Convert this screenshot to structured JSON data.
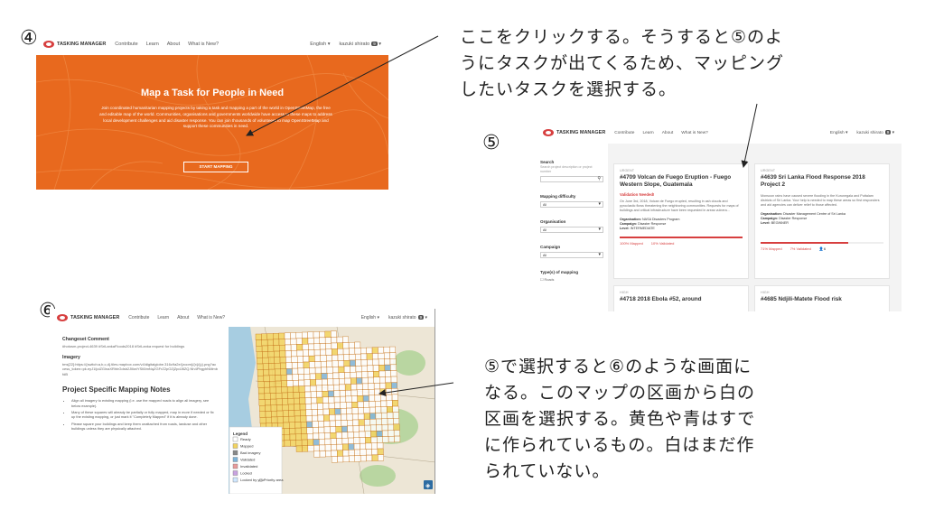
{
  "steps": {
    "four": "④",
    "five": "⑤",
    "six": "⑥"
  },
  "note_top": {
    "lines": [
      "ここをクリックする。そうすると⑤のよ",
      "うにタスクが出てくるため、マッピング",
      "したいタスクを選択する。"
    ]
  },
  "note_bottom": {
    "lines": [
      "⑤で選択すると⑥のような画面に",
      "なる。このマップの区画から白の",
      "区画を選択する。黄色や青はすで",
      "に作られているもの。白はまだ作",
      "られていない。"
    ]
  },
  "nav": {
    "logo_text": "TASKING MANAGER",
    "links": [
      "Contribute",
      "Learn",
      "About",
      "What is New?"
    ],
    "language": "English",
    "user": "kazuki shirato",
    "user_badge": "9"
  },
  "hero": {
    "title": "Map a Task for People in Need",
    "body": "Join coordinated humanitarian mapping projects by taking a task and mapping a part of the world in OpenStreetMap, the free and editable map of the world. Communities, organisations and governments worldwide have access to these maps to address local development challenges and aid disaster response. You can join thousands of volunteers to map OpenStreetMap and support these communities in need.",
    "button": "START MAPPING"
  },
  "filters": {
    "search_label": "Search",
    "search_hint": "Search project description or project number",
    "mapping_difficulty": "Mapping difficulty",
    "organisation": "Organisation",
    "campaign": "Campaign",
    "select_value": "All",
    "types_label": "Type(s) of mapping",
    "types_first": "Roads"
  },
  "cards": [
    {
      "priority": "URGENT",
      "title": "#4709 Volcan de Fuego Eruption - Fuego Western Slope, Guatemala",
      "validation": "Validation Needed!",
      "description": "On June 3rd, 2018, Volcan de Fuego erupted, resulting in ash clouds and pyroclastic flows threatening the neighboring communities. Requests for maps of buildings and critical infrastructure have been requested in areas vulnera...",
      "org_label": "Organisation:",
      "org": "NASA Disasters Program",
      "campaign_label": "Campaign:",
      "campaign": "Disaster Response",
      "level_label": "Level:",
      "level": "INTERMEDIATE",
      "mapped": "100% Mapped",
      "validated": "10% Validated",
      "mapped_fraction": 1.0
    },
    {
      "priority": "URGENT",
      "title": "#4639 Sri Lanka Flood Response 2018 Project 2",
      "validation": "",
      "description": "Monsoon rains have caused severe flooding in the Kurunegala and Puttalam districts of Sri Lanka. Your help is needed to map these areas so first responders and aid agencies can deliver relief to those affected.",
      "org_label": "Organisation:",
      "org": "Disaster Management Centre of Sri Lanka",
      "campaign_label": "Campaign:",
      "campaign": "Disaster Response",
      "level_label": "Level:",
      "level": "BEGINNER",
      "mapped": "71% Mapped",
      "validated": "7% Validated",
      "extra": "6",
      "mapped_fraction": 0.71
    },
    {
      "priority": "HIGH",
      "title": "#4718 2018 Ebola #52, around",
      "validation": "",
      "description": "",
      "mapped_fraction": 0
    },
    {
      "priority": "HIGH",
      "title": "#4685 Ndjili-Matete Flood risk",
      "validation": "",
      "description": "",
      "mapped_fraction": 0
    }
  ],
  "detail": {
    "changeset_label": "Changeset Comment",
    "changeset": "#hotosm-project-4639 #SriLankaFloods2018 #SriLanka request for buildings",
    "imagery_label": "Imagery",
    "imagery": "tms[22]:https://{switch:a,b,c,d}.tiles.mapbox.com/v4/digitalglobe.316c9a2e/{zoom}/{x}/{y}.png?access_token=pk.eyJ1IjoiZGlnaXRhbGdsb2JlIiwiYSI6ImNqZGFrZ2pOZjZpdJ8ZQ.Nh4PbgyhNMmbfdB",
    "notes_title": "Project Specific Mapping Notes",
    "notes": [
      "Align all imagery to existing mapping (i.e. use the mapped roads to align all imagery, see below example).",
      "Many of these squares will already be partially or fully mapped, map in more if needed or fix up the existing mapping, or just mark it \"Completely Mapped\" if it is already done.",
      "Please square your buildings and keep them unattached from roads, landuse and other buildings unless they are physically attached."
    ]
  },
  "legend": {
    "title": "Legend",
    "items": [
      "Ready",
      "Mapped",
      "Bad imagery",
      "Validated",
      "Invalidated",
      "Locked",
      "Locked by you"
    ],
    "colors": [
      "#ffffff",
      "#f2d35f",
      "#888888",
      "#7fb4d9",
      "#e89a9a",
      "#c8a2e0",
      "#d0e8ff"
    ],
    "priority": "Priority area"
  },
  "colors": {
    "hero_orange": "#e8691e",
    "brand_red": "#d73f3f",
    "grid_yellow": "#f2d35f",
    "grid_white": "#ffffff",
    "grid_blue": "#7fb4d9",
    "land": "#ede6d6",
    "sea": "#a7cde1",
    "forest": "#b9d6a1"
  }
}
